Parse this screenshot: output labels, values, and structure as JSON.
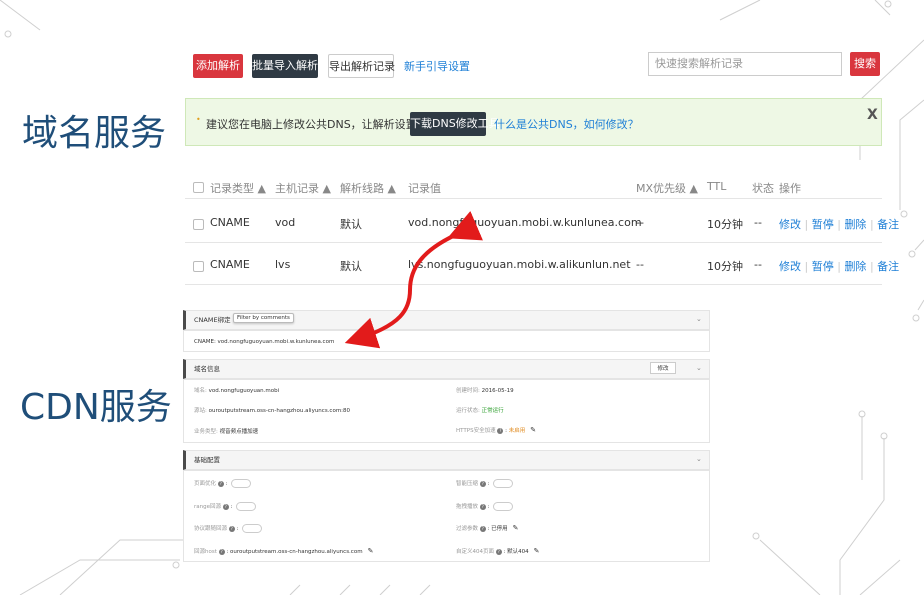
{
  "section_titles": {
    "dns": "域名服务",
    "cdn": "CDN服务"
  },
  "toolbar": {
    "add_label": "添加解析",
    "import_label": "批量导入解析",
    "export_label": "导出解析记录",
    "guide_label": "新手引导设置",
    "search_placeholder": "快速搜索解析记录",
    "search_label": "搜索"
  },
  "notice": {
    "text": "建议您在电脑上修改公共DNS，让解析设置实时生效。",
    "tool_button": "下载DNS修改工具",
    "link": "什么是公共DNS，如何修改？",
    "close": "X"
  },
  "table": {
    "headers": [
      "记录类型 ▲",
      "主机记录 ▲",
      "解析线路 ▲",
      "记录值",
      "MX优先级 ▲",
      "TTL",
      "状态",
      "操作"
    ],
    "rows": [
      {
        "type": "CNAME",
        "host": "vod",
        "line": "默认",
        "value": "vod.nongfuguoyuan.mobi.w.kunlunea.com",
        "mx": "--",
        "ttl": "10分钟",
        "status": "--"
      },
      {
        "type": "CNAME",
        "host": "lvs",
        "line": "默认",
        "value": "lvs.nongfuguoyuan.mobi.w.alikunlun.net",
        "mx": "--",
        "ttl": "10分钟",
        "status": "--"
      }
    ],
    "ops": [
      "修改",
      "暂停",
      "删除",
      "备注"
    ]
  },
  "cdn": {
    "cname_section": "CNAME绑定",
    "tooltip": "Filter by comments",
    "cname_value": "CNAME: vod.nongfuguoyuan.mobi.w.kunlunea.com",
    "domain_section": "域名信息",
    "modify_button": "修改",
    "domain": {
      "label": "域名:",
      "value": "vod.nongfuguoyuan.mobi"
    },
    "created": {
      "label": "创建时间:",
      "value": "2016-05-19"
    },
    "origin": {
      "label": "源站:",
      "value": "ouroutputstream.oss-cn-hangzhou.aliyuncs.com:80"
    },
    "run_status": {
      "label": "运行状态:",
      "value": "正常运行"
    },
    "biz_type": {
      "label": "业务类型:",
      "value": "视音频点播加速"
    },
    "https": {
      "label": "HTTPS安全加速",
      "value": "未启用"
    },
    "basic_section": "基础配置",
    "page_opt": "页面优化",
    "smart_compress": "智能压缩",
    "range_origin": "range回源",
    "drag_play": "拖拽播放",
    "follow_origin": "协议跟随回源",
    "filter_params": {
      "label": "过滤参数",
      "value": "已停用"
    },
    "origin_host": {
      "label": "回源host",
      "value": "ouroutputstream.oss-cn-hangzhou.aliyuncs.com"
    },
    "custom_404": {
      "label": "自定义404页面",
      "value": "默认404"
    }
  },
  "colors": {
    "accent_red": "#d9363e",
    "title_blue": "#1f4e79",
    "link_blue": "#1e7fd6",
    "arrow": "#e21b1b"
  }
}
